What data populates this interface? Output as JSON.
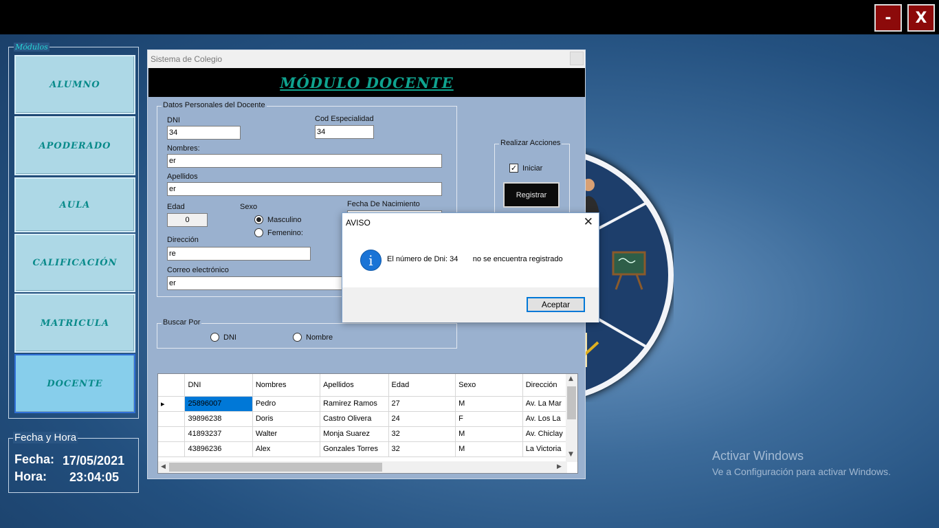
{
  "window_controls": {
    "minimize_label": "-",
    "close_label": "X",
    "accent": "#8c0a0a"
  },
  "modules": {
    "legend": "Módulos",
    "items": [
      {
        "label": "ALUMNO"
      },
      {
        "label": "APODERADO"
      },
      {
        "label": "AULA"
      },
      {
        "label": "CALIFICACIÓN"
      },
      {
        "label": "MATRICULA"
      },
      {
        "label": "DOCENTE"
      }
    ],
    "active": "DOCENTE"
  },
  "datetime": {
    "legend": "Fecha y Hora",
    "fecha_label": "Fecha:",
    "fecha_value": "17/05/2021",
    "hora_label": "Hora:",
    "hora_value": "23:04:05"
  },
  "form": {
    "window_title": "Sistema de Colegio",
    "banner": "MÓDULO DOCENTE",
    "personal": {
      "legend": "Datos Personales del Docente",
      "dni_label": "DNI",
      "dni_value": "34",
      "cod_label": "Cod Especialidad",
      "cod_value": "34",
      "nombres_label": "Nombres:",
      "nombres_value": "er",
      "apellidos_label": "Apellidos",
      "apellidos_value": "er",
      "edad_label": "Edad",
      "edad_value": "0",
      "sexo_label": "Sexo",
      "sexo_masculino": "Masculino",
      "sexo_femenino": "Femenino:",
      "sexo_selected": "Masculino",
      "fecha_nac_label": "Fecha De Nacimiento",
      "direccion_label": "Dirección",
      "direccion_value": "re",
      "correo_label": "Correo electrónico",
      "correo_value": "er"
    },
    "acciones": {
      "legend": "Realizar Acciones",
      "iniciar_label": "Iniciar",
      "iniciar_checked": true,
      "registrar_label": "Registrar"
    },
    "buscar": {
      "legend": "Buscar Por",
      "option_dni": "DNI",
      "option_nombre": "Nombre"
    },
    "grid": {
      "columns": [
        "DNI",
        "Nombres",
        "Apellidos",
        "Edad",
        "Sexo",
        "Dirección"
      ],
      "rows": [
        [
          "25896007",
          "Pedro",
          "Ramirez Ramos",
          "27",
          "M",
          "Av. La Mar"
        ],
        [
          "39896238",
          "Doris",
          "Castro Olivera",
          "24",
          "F",
          "Av. Los La"
        ],
        [
          "41893237",
          "Walter",
          "Monja Suarez",
          "32",
          "M",
          "Av. Chiclay"
        ],
        [
          "43896236",
          "Alex",
          "Gonzales Torres",
          "32",
          "M",
          "La Victoria"
        ]
      ]
    }
  },
  "dialog": {
    "title": "AVISO",
    "message": "El número de Dni: 34       no se encuentra registrado",
    "ok_label": "Aceptar"
  },
  "watermark": {
    "line1": "Activar Windows",
    "line2": "Ve a Configuración para activar Windows."
  }
}
